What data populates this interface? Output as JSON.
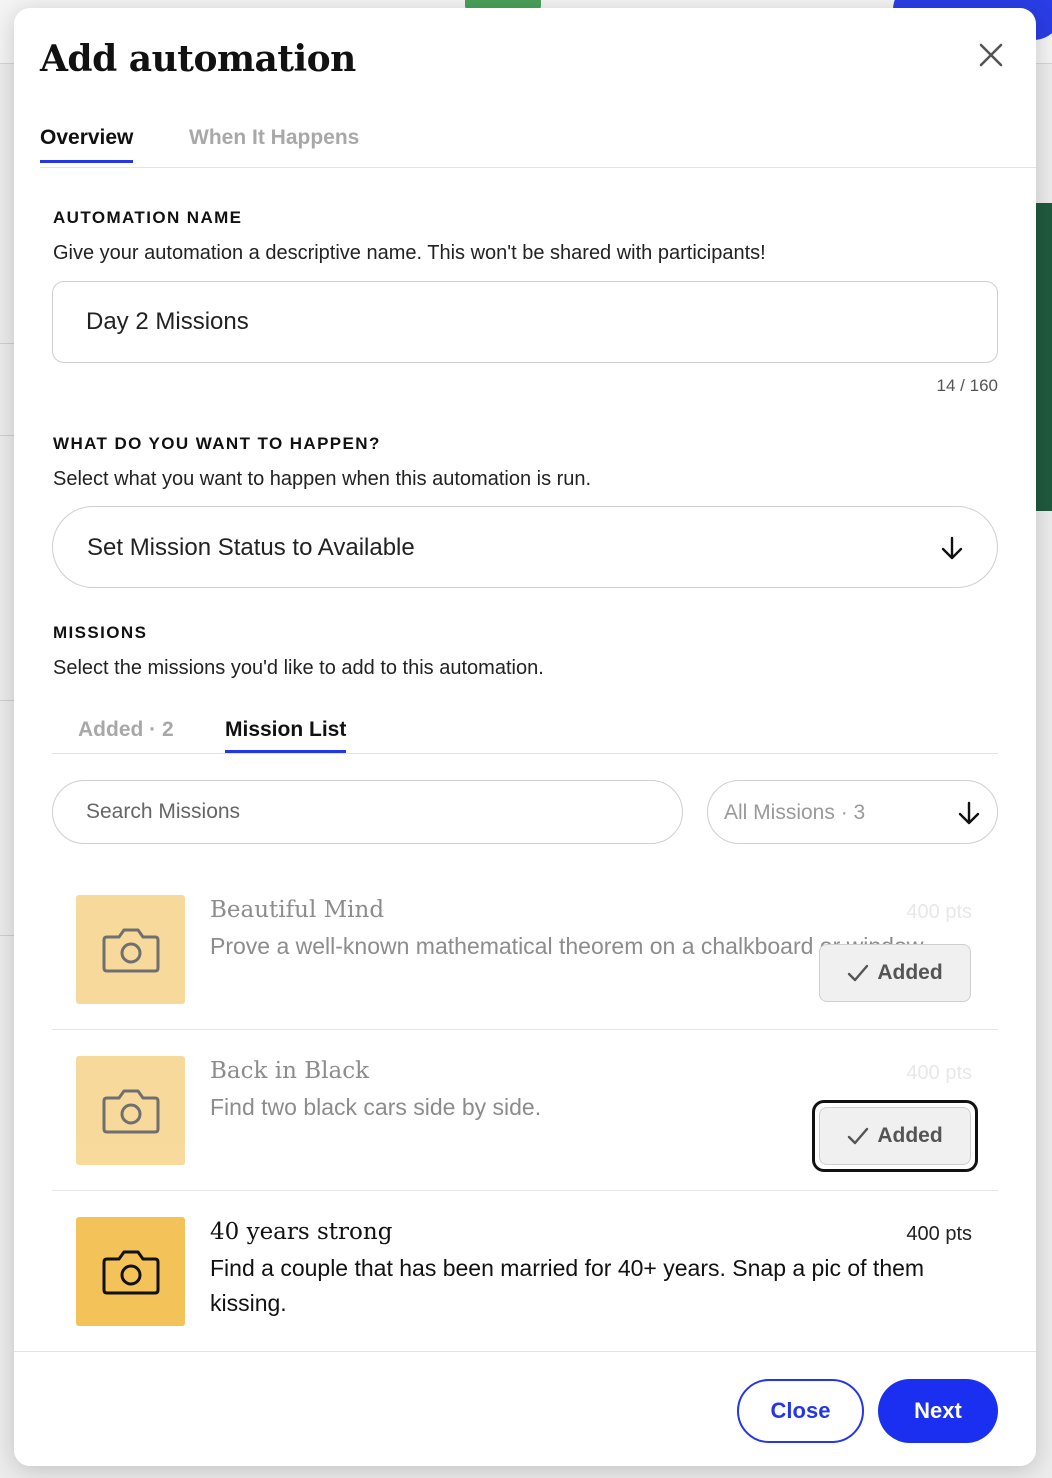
{
  "modal": {
    "title": "Add automation"
  },
  "tabs": [
    {
      "label": "Overview",
      "active": true
    },
    {
      "label": "When It Happens",
      "active": false
    }
  ],
  "automation_name": {
    "label": "AUTOMATION NAME",
    "help": "Give your automation a descriptive name. This won't be shared with participants!",
    "value": "Day 2 Missions",
    "counter": "14 / 160"
  },
  "action": {
    "label": "WHAT DO YOU WANT TO HAPPEN?",
    "help": "Select what you want to happen when this automation is run.",
    "selected": "Set Mission Status to Available"
  },
  "missions": {
    "label": "MISSIONS",
    "help": "Select the missions you'd like to add to this automation.",
    "tabs": [
      {
        "label": "Added · 2",
        "active": false
      },
      {
        "label": "Mission List",
        "active": true
      }
    ],
    "search_placeholder": "Search Missions",
    "filter": "All Missions · 3",
    "items": [
      {
        "title": "Beautiful Mind",
        "description": "Prove a well-known mathematical theorem on a chalkboard or window.",
        "points": "400 pts",
        "button": "Added",
        "added": true
      },
      {
        "title": "Back in Black",
        "description": "Find two black cars side by side.",
        "points": "400 pts",
        "button": "Added",
        "added": true
      },
      {
        "title": "40 years strong",
        "description": "Find a couple that has been married for 40+ years. Snap a pic of them kissing.",
        "points": "400 pts",
        "added": false
      }
    ]
  },
  "footer": {
    "close": "Close",
    "next": "Next"
  },
  "icons": {
    "close": "close-icon",
    "dropdown": "arrow-down-icon",
    "mission_thumb": "camera-icon",
    "added": "check-icon"
  },
  "colors": {
    "accent": "#2337e6",
    "next_button": "#1a2ff0",
    "thumb_yellow": "#f3c35a",
    "thumb_yellow_faded": "#f8d98f"
  }
}
